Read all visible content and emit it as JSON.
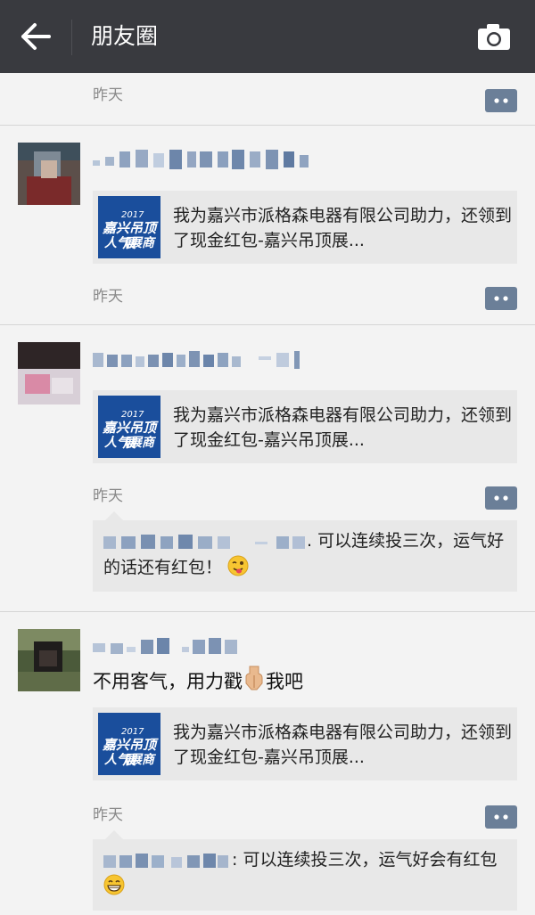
{
  "header": {
    "title": "朋友圈"
  },
  "posts": [
    {
      "time": "昨天"
    },
    {
      "share": {
        "text": "我为嘉兴市派格森电器有限公司助力，还领到了现金红包-嘉兴吊顶展...",
        "thumb_line1": "嘉兴吊顶展",
        "thumb_line2": "人气展商",
        "thumb_year": "2017"
      },
      "time": "昨天"
    },
    {
      "share": {
        "text": "我为嘉兴市派格森电器有限公司助力，还领到了现金红包-嘉兴吊顶展...",
        "thumb_line1": "嘉兴吊顶展",
        "thumb_line2": "人气展商",
        "thumb_year": "2017"
      },
      "time": "昨天",
      "comment": ". 可以连续投三次，运气好的话还有红包！"
    },
    {
      "text_before": "不用客气，用力戳",
      "text_after": "我吧",
      "share": {
        "text": "我为嘉兴市派格森电器有限公司助力，还领到了现金红包-嘉兴吊顶展...",
        "thumb_line1": "嘉兴吊顶展",
        "thumb_line2": "人气展商",
        "thumb_year": "2017"
      },
      "time": "昨天",
      "comment": ": 可以连续投三次，运气好会有红包"
    }
  ],
  "colors": {
    "topbar": "#393a3f",
    "background": "#f3f3f3",
    "card": "#e8e8e8",
    "timestamp": "#8a8a8a"
  }
}
